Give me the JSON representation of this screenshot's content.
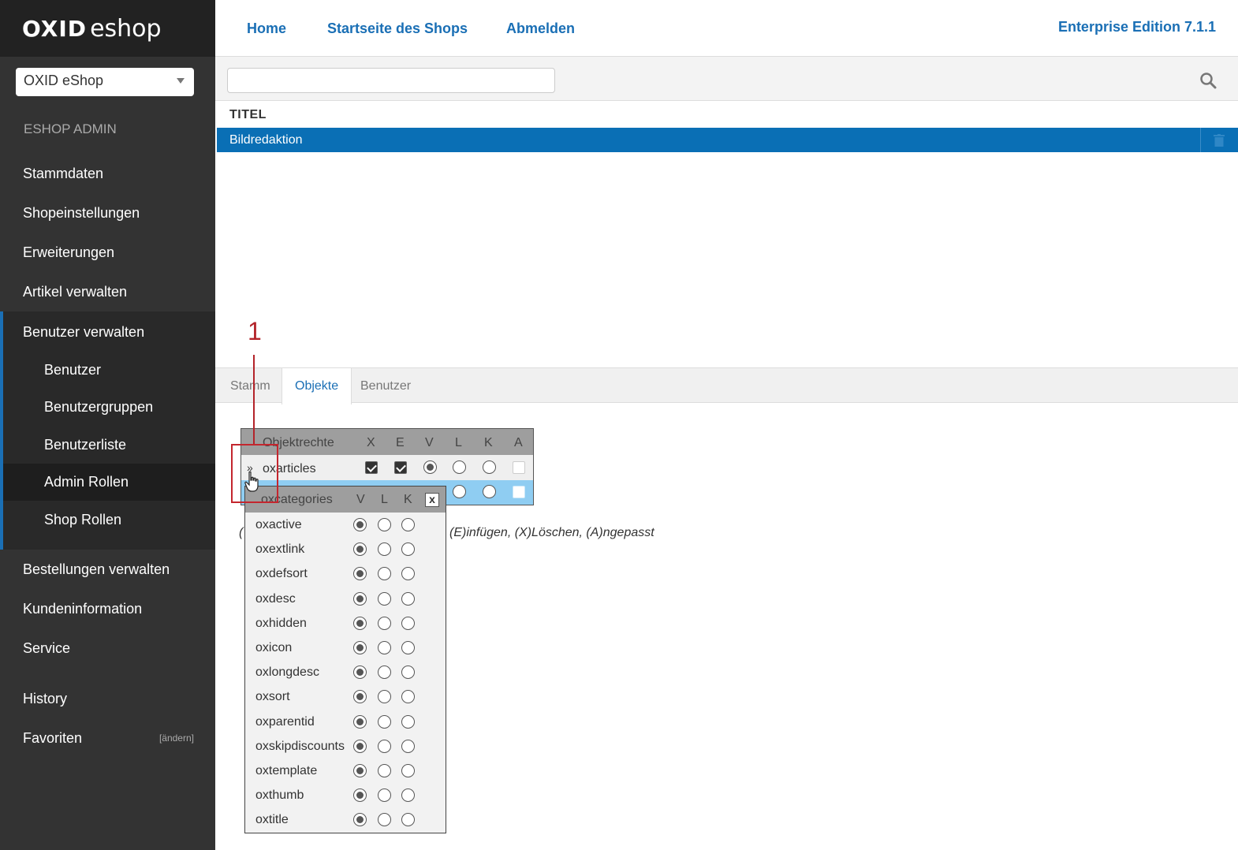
{
  "logo": {
    "brand_bold": "OXID",
    "brand_light": "eshop"
  },
  "shop_select": {
    "value": "OXID eShop"
  },
  "sidebar": {
    "section_label": "ESHOP ADMIN",
    "items": [
      {
        "label": "Stammdaten"
      },
      {
        "label": "Shopeinstellungen"
      },
      {
        "label": "Erweiterungen"
      },
      {
        "label": "Artikel verwalten"
      },
      {
        "label": "Benutzer verwalten"
      }
    ],
    "sub_items": [
      {
        "label": "Benutzer"
      },
      {
        "label": "Benutzergruppen"
      },
      {
        "label": "Benutzerliste"
      },
      {
        "label": "Admin Rollen"
      },
      {
        "label": "Shop Rollen"
      }
    ],
    "bottom_items": [
      {
        "label": "Bestellungen verwalten"
      },
      {
        "label": "Kundeninformation"
      },
      {
        "label": "Service"
      },
      {
        "label": "History"
      },
      {
        "label": "Favoriten"
      }
    ],
    "fav_change": "[ändern]"
  },
  "header": {
    "links": [
      "Home",
      "Startseite des Shops",
      "Abmelden"
    ],
    "edition": "Enterprise Edition 7.1.1"
  },
  "search": {
    "value": "",
    "icon": "search-icon"
  },
  "list": {
    "column_header": "TITEL",
    "rows": [
      {
        "title": "Bildredaktion",
        "selected": true
      }
    ]
  },
  "tabs": [
    {
      "label": "Stamm",
      "active": false
    },
    {
      "label": "Objekte",
      "active": true
    },
    {
      "label": "Benutzer",
      "active": false
    }
  ],
  "rights_table": {
    "header": [
      "Objektrechte",
      "X",
      "E",
      "V",
      "L",
      "K",
      "A"
    ],
    "row_articles": {
      "name": "oxarticles",
      "expander": "»"
    }
  },
  "legend": {
    "start": "(",
    "text": "(E)infügen, (X)Löschen, (A)ngepasst"
  },
  "popup": {
    "header": [
      "oxcategories",
      "V",
      "L",
      "K"
    ],
    "close_label": "x",
    "fields": [
      "oxactive",
      "oxextlink",
      "oxdefsort",
      "oxdesc",
      "oxhidden",
      "oxicon",
      "oxlongdesc",
      "oxsort",
      "oxparentid",
      "oxskipdiscounts",
      "oxtemplate",
      "oxthumb",
      "oxtitle"
    ]
  },
  "annotation": {
    "number": "1"
  },
  "colors": {
    "accent": "#1a6fb5",
    "sidebar_bg": "#333333",
    "selected_row": "#0a6fb5",
    "annotation": "#c4262e"
  }
}
